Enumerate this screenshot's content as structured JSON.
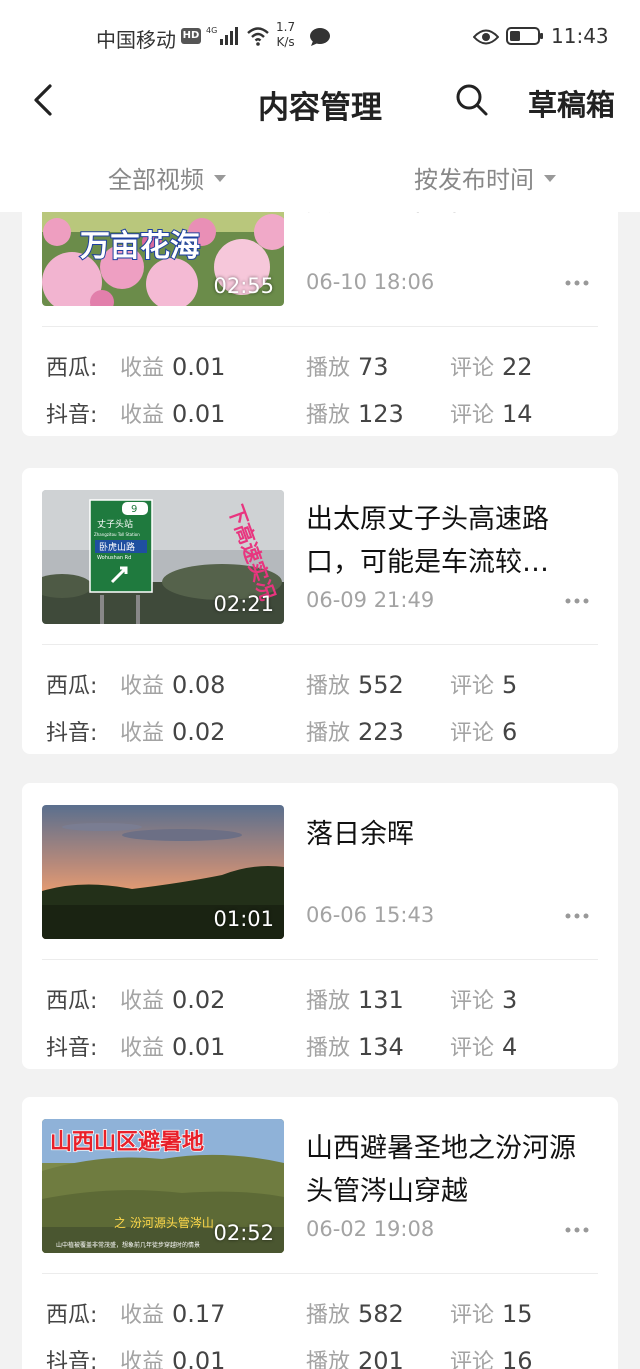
{
  "status_bar": {
    "carrier": "中国移动",
    "hd": "HD",
    "network": "4G",
    "speed_value": "1.7",
    "speed_unit": "K/s",
    "time": "11:43"
  },
  "header": {
    "title": "内容管理",
    "drafts": "草稿箱"
  },
  "filters": {
    "category": "全部视频",
    "sort": "按发布时间"
  },
  "videos": [
    {
      "thumb_text": "万亩花海",
      "duration": "02:55",
      "title": "中国芍乡，芍乡中山，只为寻你而来。",
      "date": "06-10 18:06",
      "stats": [
        {
          "platform": "西瓜:",
          "income_label": "收益",
          "income": "0.01",
          "play_label": "播放",
          "plays": "73",
          "comment_label": "评论",
          "comments": "22"
        },
        {
          "platform": "抖音:",
          "income_label": "收益",
          "income": "0.01",
          "play_label": "播放",
          "plays": "123",
          "comment_label": "评论",
          "comments": "14"
        }
      ]
    },
    {
      "thumb_text": "下高速实况",
      "sign_top": "丈子头站",
      "sign_en": "Zhangzitou Toll Station",
      "sign_road": "卧虎山路",
      "sign_road_en": "Wohushan Rd",
      "sign_num": "9",
      "duration": "02:21",
      "title": "出太原丈子头高速路口，可能是车流较…",
      "date": "06-09 21:49",
      "stats": [
        {
          "platform": "西瓜:",
          "income_label": "收益",
          "income": "0.08",
          "play_label": "播放",
          "plays": "552",
          "comment_label": "评论",
          "comments": "5"
        },
        {
          "platform": "抖音:",
          "income_label": "收益",
          "income": "0.02",
          "play_label": "播放",
          "plays": "223",
          "comment_label": "评论",
          "comments": "6"
        }
      ]
    },
    {
      "duration": "01:01",
      "title": "落日余晖",
      "date": "06-06 15:43",
      "stats": [
        {
          "platform": "西瓜:",
          "income_label": "收益",
          "income": "0.02",
          "play_label": "播放",
          "plays": "131",
          "comment_label": "评论",
          "comments": "3"
        },
        {
          "platform": "抖音:",
          "income_label": "收益",
          "income": "0.01",
          "play_label": "播放",
          "plays": "134",
          "comment_label": "评论",
          "comments": "4"
        }
      ]
    },
    {
      "thumb_text": "山西山区避暑地",
      "thumb_sub": "之  汾河源头管涔山",
      "thumb_caption": "山中植被覆盖非常茂盛，想象前几年徒步穿越时的情景",
      "duration": "02:52",
      "title": "山西避暑圣地之汾河源头管涔山穿越",
      "date": "06-02 19:08",
      "stats": [
        {
          "platform": "西瓜:",
          "income_label": "收益",
          "income": "0.17",
          "play_label": "播放",
          "plays": "582",
          "comment_label": "评论",
          "comments": "15"
        },
        {
          "platform": "抖音:",
          "income_label": "收益",
          "income": "0.01",
          "play_label": "播放",
          "plays": "201",
          "comment_label": "评论",
          "comments": "16"
        }
      ]
    }
  ]
}
